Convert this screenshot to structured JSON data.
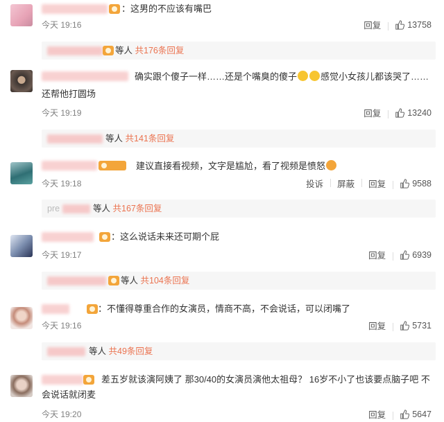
{
  "comments": [
    {
      "text": "：这男的不应该有嘴巴",
      "time": "今天 19:16",
      "likes": "13758",
      "reply": "回复",
      "replies_others": "等人",
      "replies_count": "共176条回复"
    },
    {
      "text": "确实跟个傻子一样……还是个嘴臭的傻子",
      "text2": "感觉小女孩儿都该哭了……",
      "text3": "还帮他打圆场",
      "time": "今天 19:19",
      "likes": "13240",
      "reply": "回复",
      "replies_others": "等人",
      "replies_count": "共141条回复"
    },
    {
      "text": "建议直接看视频，文字是尴尬，看了视频是愤怒",
      "time": "今天 19:18",
      "likes": "9588",
      "report": "投诉",
      "block": "屏蔽",
      "reply": "回复",
      "replies_prefix": "pre",
      "replies_others": "等人",
      "replies_count": "共167条回复"
    },
    {
      "text": "：这么说话未来还可期个屁",
      "time": "今天 19:17",
      "likes": "6939",
      "reply": "回复",
      "replies_others": "等人",
      "replies_count": "共104条回复"
    },
    {
      "text": "：不懂得尊重合作的女演员，情商不高，不会说话，可以闭嘴了",
      "time": "今天 19:16",
      "likes": "5731",
      "reply": "回复",
      "replies_others": "等人",
      "replies_count": "共49条回复"
    },
    {
      "text": "差五岁就该演阿姨了 那30/40的女演员演他太祖母？ 16岁不小了也该要点脑子吧 不",
      "text2": "会说话就闭麦",
      "time": "今天 19:20",
      "likes": "5647",
      "reply": "回复"
    }
  ],
  "colors": {
    "accent": "#eb7350",
    "time": "#808080",
    "reply_bg": "#f6f6f6"
  },
  "icons": {
    "like": "thumbs-up-icon",
    "badge": "vip-badge-icon",
    "emoji": "face-emoji-icon"
  }
}
